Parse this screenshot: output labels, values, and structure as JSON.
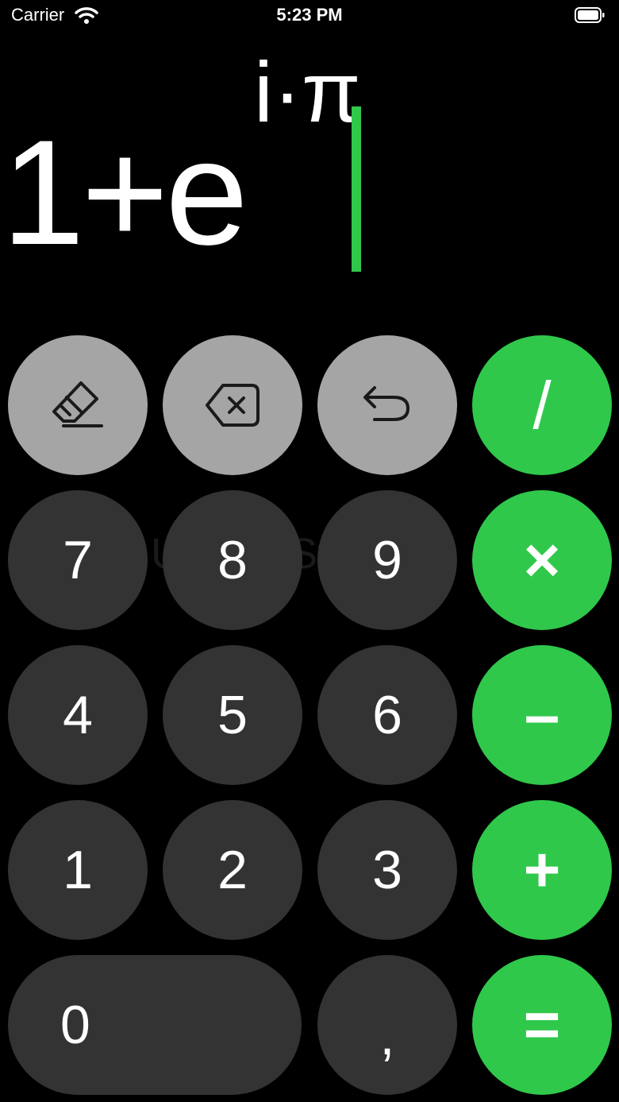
{
  "status_bar": {
    "carrier": "Carrier",
    "time": "5:23 PM"
  },
  "display": {
    "base": "1+e",
    "exponent": "i·π",
    "cursor_color": "#30c84b"
  },
  "keys": {
    "clear_icon": "eraser-icon",
    "backspace_icon": "backspace-icon",
    "undo_icon": "undo-icon",
    "divide": "/",
    "multiply": "×",
    "subtract": "–",
    "add": "+",
    "equals": "=",
    "d0": "0",
    "d1": "1",
    "d2": "2",
    "d3": "3",
    "d4": "4",
    "d5": "5",
    "d6": "6",
    "d7": "7",
    "d8": "8",
    "d9": "9",
    "comma": ","
  },
  "watermark": "UpdateStar.com",
  "colors": {
    "accent": "#30c84b",
    "function_key": "#a5a5a5",
    "digit_key": "#333333",
    "background": "#000000"
  }
}
